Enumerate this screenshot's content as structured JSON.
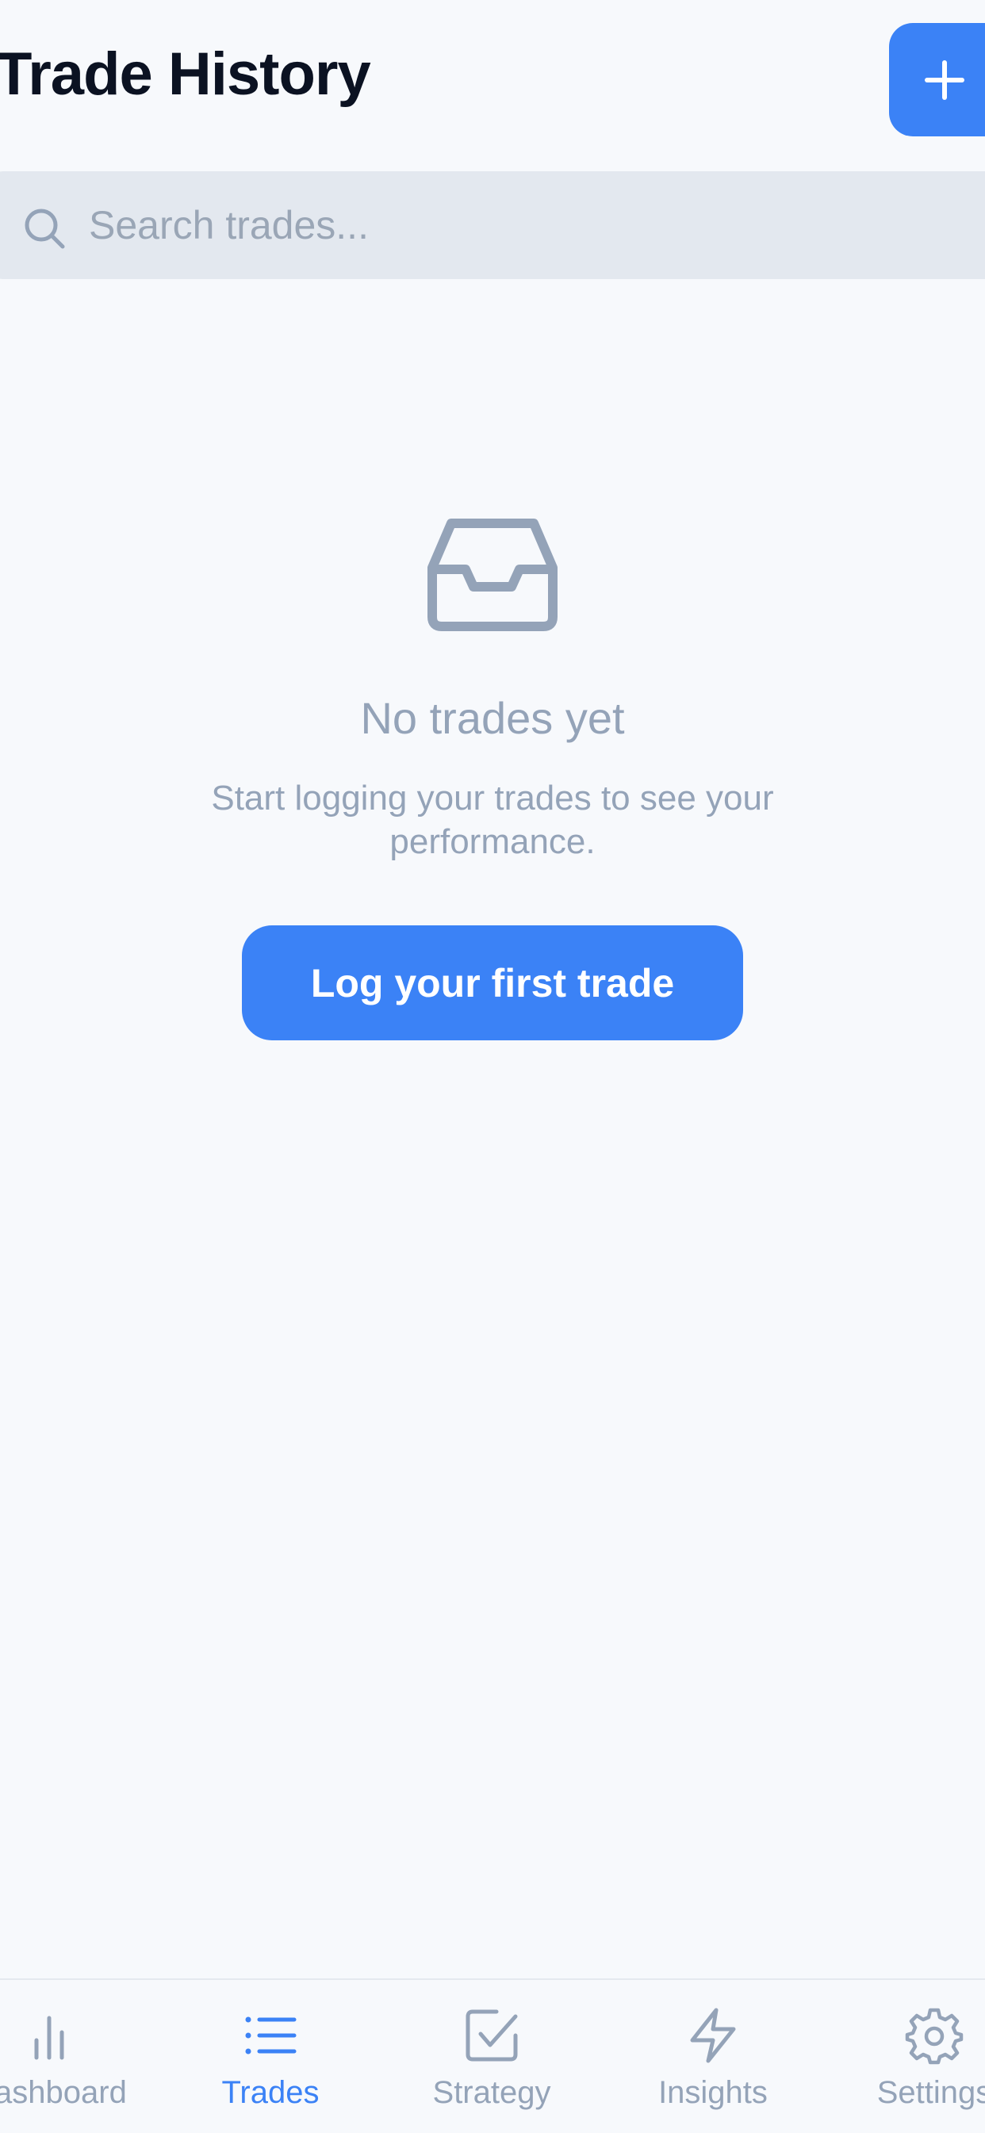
{
  "header": {
    "title": "Trade History",
    "add_icon": "plus-icon"
  },
  "search": {
    "placeholder": "Search trades...",
    "value": "",
    "icon": "search-icon"
  },
  "empty_state": {
    "icon": "inbox-icon",
    "title": "No trades yet",
    "subtitle": "Start logging your trades to see your performance.",
    "cta_label": "Log your first trade"
  },
  "tabbar": {
    "items": [
      {
        "label": "Dashboard",
        "icon": "bar-chart-icon",
        "active": false
      },
      {
        "label": "Trades",
        "icon": "list-icon",
        "active": true
      },
      {
        "label": "Strategy",
        "icon": "checkbox-icon",
        "active": false
      },
      {
        "label": "Insights",
        "icon": "lightning-icon",
        "active": false
      },
      {
        "label": "Settings",
        "icon": "gear-icon",
        "active": false
      }
    ]
  },
  "colors": {
    "accent": "#3b82f6",
    "background": "#f7f9fc",
    "muted": "#94a3b8",
    "search_bg": "#e3e8ef"
  }
}
